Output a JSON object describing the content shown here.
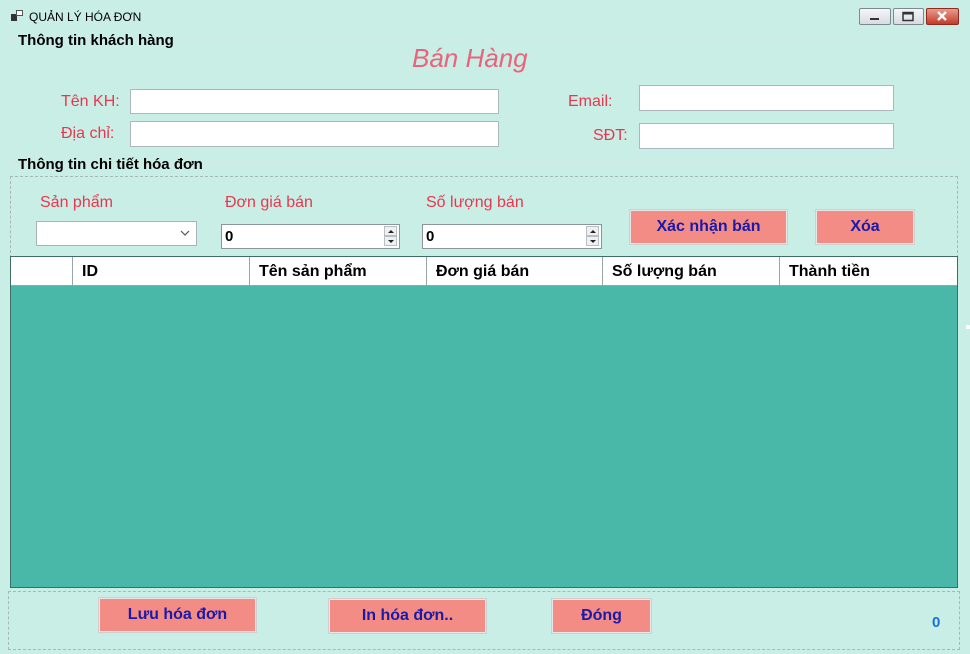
{
  "window": {
    "title": "QUẢN LÝ HÓA ĐƠN",
    "controls": [
      "minimize-icon",
      "maximize-icon",
      "close-icon"
    ]
  },
  "customer_group": {
    "title": "Thông tin khách hàng",
    "heading": "Bán Hàng",
    "name_label": "Tên KH:",
    "name_value": "",
    "address_label": "Địa chỉ:",
    "address_value": "",
    "email_label": "Email:",
    "email_value": "",
    "phone_label": "SĐT:",
    "phone_value": ""
  },
  "detail_group": {
    "title": "Thông tin chi tiết hóa đơn",
    "product_label": "Sản phẩm",
    "product_value": "",
    "price_label": "Đơn giá bán",
    "price_value": "0",
    "qty_label": "Số lượng bán",
    "qty_value": "0",
    "confirm_button": "Xác nhận bán",
    "delete_button": "Xóa"
  },
  "grid": {
    "columns": [
      "",
      "ID",
      "Tên sản phẩm",
      "Đơn giá bán",
      "Số lượng bán",
      "Thành tiền"
    ],
    "rows": []
  },
  "footer": {
    "save_button": "Lưu hóa đơn",
    "print_button": "In hóa đơn..",
    "close_button": "Đóng",
    "total": "0"
  },
  "colors": {
    "background": "#c9eee6",
    "label_red": "#e8374f",
    "button_pink": "#f48c86",
    "button_text": "#1b1aa8",
    "grid_bg": "#49b8a8",
    "total_blue": "#1a6fd6"
  }
}
